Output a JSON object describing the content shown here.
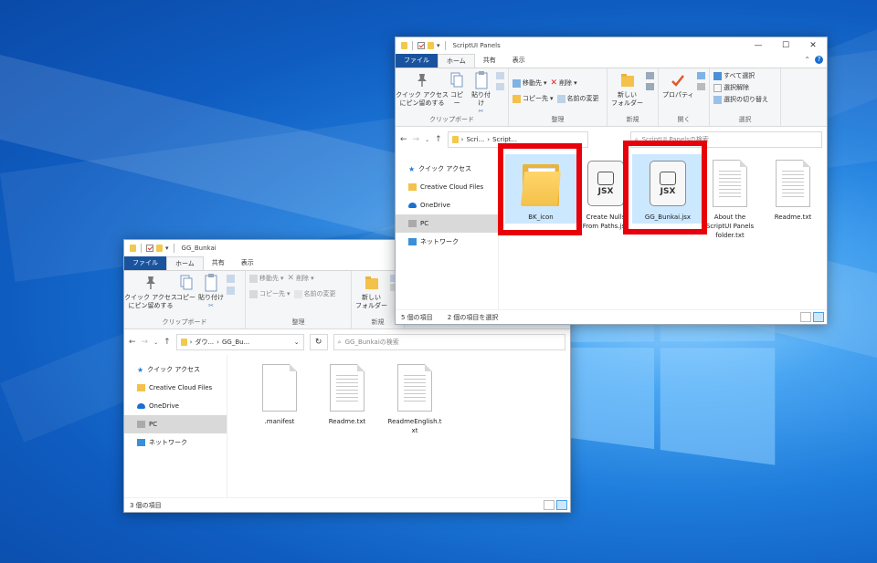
{
  "colors": {
    "file_tab": "#19539e",
    "selected": "#cce8ff",
    "highlight": "#e8000a",
    "desktop": "#1f7ddc"
  },
  "back_window": {
    "title": "GG_Bunkai",
    "tabs": [
      "ファイル",
      "ホーム",
      "共有",
      "表示"
    ],
    "ribbon": {
      "clipboard": {
        "pin": "クイック アクセス\nにピン留めする",
        "copy": "コピー",
        "paste": "貼り付け",
        "label": "クリップボード"
      },
      "organize": {
        "move": "移動先",
        "delete": "削除",
        "copy_to": "コピー先",
        "rename": "名前の変更",
        "label": "整理"
      },
      "new": {
        "new_folder": "新しい\nフォルダー",
        "label": "新規"
      },
      "open": {
        "prop": "プロ"
      }
    },
    "address": {
      "parts": [
        "ダウ...",
        "GG_Bu..."
      ],
      "search_placeholder": "GG_Bunkaiの検索"
    },
    "nav": [
      "クイック アクセス",
      "Creative Cloud Files",
      "OneDrive",
      "PC",
      "ネットワーク"
    ],
    "files": [
      ".manifest",
      "Readme.txt",
      "ReadmeEnglish.t\nxt"
    ],
    "status": "3 個の項目"
  },
  "front_window": {
    "title": "ScriptUI Panels",
    "tabs": [
      "ファイル",
      "ホーム",
      "共有",
      "表示"
    ],
    "ribbon": {
      "clipboard": {
        "pin": "クイック アクセス\nにピン留めする",
        "copy": "コピー",
        "paste": "貼り付け",
        "label": "クリップボード"
      },
      "organize": {
        "move": "移動先",
        "delete": "削除",
        "copy_to": "コピー先",
        "rename": "名前の変更",
        "label": "整理"
      },
      "new": {
        "new_folder": "新しい\nフォルダー",
        "label": "新規"
      },
      "open": {
        "properties": "プロパティ",
        "label": "開く"
      },
      "select": {
        "all": "すべて選択",
        "none": "選択解除",
        "invert": "選択の切り替え",
        "label": "選択"
      }
    },
    "address": {
      "parts": [
        "Scri...",
        "Script..."
      ],
      "search_placeholder": "ScriptUI Panelsの検索"
    },
    "nav": [
      "クイック アクセス",
      "Creative Cloud Files",
      "OneDrive",
      "PC",
      "ネットワーク"
    ],
    "files": [
      "BK_icon",
      "Create Nulls\nFrom Paths.jsx",
      "GG_Bunkai.jsx",
      "About the\nScriptUI Panels\nfolder.txt",
      "Readme.txt"
    ],
    "jsx_label": "JSX",
    "status": "5 個の項目",
    "status_selected": "2 個の項目を選択"
  }
}
